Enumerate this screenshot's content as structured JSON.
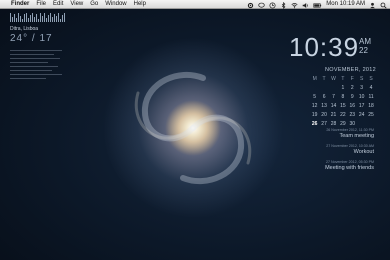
{
  "menubar": {
    "apple_glyph": "",
    "app_name": "Finder",
    "menus": [
      "File",
      "Edit",
      "View",
      "Go",
      "Window",
      "Help"
    ],
    "clock": "Mon 10:19 AM"
  },
  "weather": {
    "city": "Ditra, Lisboa",
    "temp": "24° / 17"
  },
  "clock": {
    "time": "10:39",
    "ampm": "AM",
    "seconds": "22"
  },
  "calendar": {
    "month": "NOVEMBER, 2012",
    "weekdays": [
      "M",
      "T",
      "W",
      "T",
      "F",
      "S",
      "S"
    ],
    "weeks": [
      [
        "",
        "",
        "",
        "1",
        "2",
        "3",
        "4"
      ],
      [
        "5",
        "6",
        "7",
        "8",
        "9",
        "10",
        "11"
      ],
      [
        "12",
        "13",
        "14",
        "15",
        "16",
        "17",
        "18"
      ],
      [
        "19",
        "20",
        "21",
        "22",
        "23",
        "24",
        "25"
      ],
      [
        "26",
        "27",
        "28",
        "29",
        "30",
        "",
        ""
      ]
    ],
    "today": "26"
  },
  "events": [
    {
      "time": "26 November 2012, 11:30 PM",
      "title": "Team meeting"
    },
    {
      "time": "27 November 2012, 10:30 AM",
      "title": "Workout"
    },
    {
      "time": "27 November 2012, 05:30 PM",
      "title": "Meeting with friends"
    }
  ],
  "colors": {
    "widget_text": "#c8d4e2",
    "menubar_bg": "#e6e6e6"
  }
}
